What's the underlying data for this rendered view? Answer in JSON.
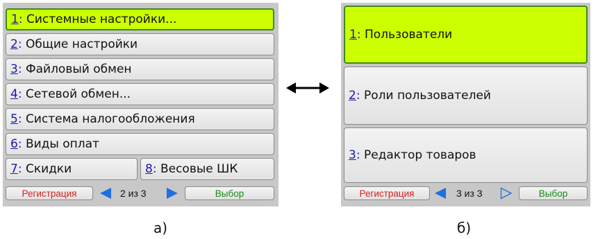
{
  "screen_a": {
    "items": [
      {
        "num": "1",
        "label": "Системные настройки..."
      },
      {
        "num": "2",
        "label": "Общие настройки"
      },
      {
        "num": "3",
        "label": "Файловый обмен"
      },
      {
        "num": "4",
        "label": "Сетевой обмен..."
      },
      {
        "num": "5",
        "label": "Система налогообложения"
      },
      {
        "num": "6",
        "label": "Виды оплат"
      },
      {
        "num": "7",
        "label": "Скидки"
      },
      {
        "num": "8",
        "label": "Весовые ШК"
      }
    ],
    "selected_index": 0,
    "footer": {
      "register_label": "Регистрация",
      "page_label": "2 из 3",
      "select_label": "Выбор"
    },
    "caption": "а)"
  },
  "screen_b": {
    "items": [
      {
        "num": "1",
        "label": "Пользователи"
      },
      {
        "num": "2",
        "label": "Роли пользователей"
      },
      {
        "num": "3",
        "label": "Редактор товаров"
      }
    ],
    "selected_index": 0,
    "footer": {
      "register_label": "Регистрация",
      "page_label": "3 из 3",
      "select_label": "Выбор"
    },
    "caption": "б)"
  },
  "separator": ":",
  "colors": {
    "selected_bg": "#ccff00",
    "selected_border": "#3c8a1c",
    "number": "#1a1aa8",
    "register": "#d42020",
    "select": "#158a15",
    "arrow_blue": "#1e6fe0"
  },
  "icons": {
    "prev": "left-triangle-arrow-icon",
    "next": "right-triangle-arrow-icon",
    "next_disabled": "right-triangle-outline-icon",
    "between": "double-headed-arrow-icon"
  }
}
